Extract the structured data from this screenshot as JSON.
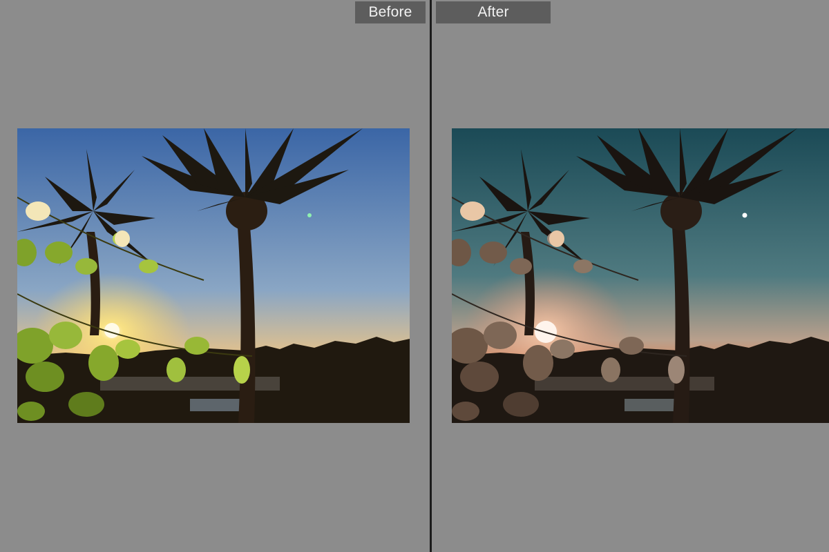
{
  "compare_view": {
    "before_label": "Before",
    "after_label": "After"
  },
  "photos": {
    "before": {
      "sky_top": "#3f6aa8",
      "sky_mid": "#86a4c6",
      "sky_horizon": "#f3c27a",
      "sun": "#fff4b0",
      "silhouette": "#1d1810",
      "leaf": "#7fa22a",
      "leaf_light": "#b7d24a",
      "flower": "#f3e6b8",
      "star": "#8ff0b0"
    },
    "after": {
      "sky_top": "#1e4f5a",
      "sky_mid": "#4e7b80",
      "sky_horizon": "#e08658",
      "sun": "#fff0e6",
      "silhouette": "#1a1410",
      "leaf": "#6e5746",
      "leaf_light": "#9c8676",
      "flower": "#e9c7a6",
      "star": "#ffffff"
    }
  }
}
